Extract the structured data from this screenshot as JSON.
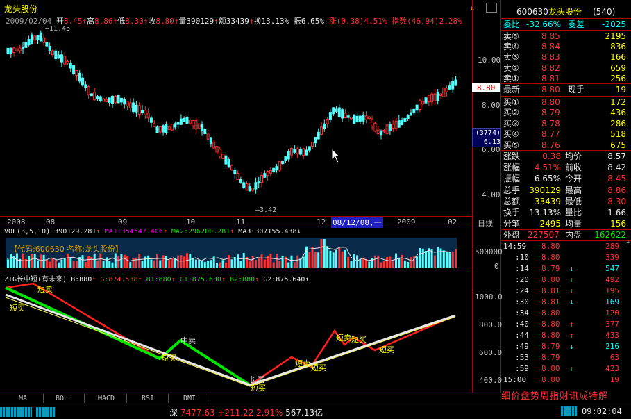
{
  "stock_name": "龙头股份",
  "quote": {
    "date": "2009/02/04",
    "open_label": "开",
    "open": "8.45",
    "high_label": "高",
    "high": "8.86",
    "low_label": "低",
    "low": "8.30",
    "close_label": "收",
    "close": "8.80",
    "vol_label": "量",
    "vol": "390129",
    "amt_label": "额",
    "amt": "33439",
    "turn_label": "换",
    "turn": "13.13%",
    "amp_label": "振",
    "amp": "6.65%",
    "chg_label": "涨",
    "chg": "(0.38)4.51%",
    "idx_label": "指数",
    "idx": "(46.94)2.28%"
  },
  "price_axis": [
    "10.00",
    "8.00",
    "6.00",
    "4.00"
  ],
  "price_tags": {
    "current": "8.80",
    "cursor_count": "(3774)",
    "cursor_price": "6.13"
  },
  "annotations": {
    "high": "11.45",
    "low": "3.42"
  },
  "x_axis": [
    "2008",
    "08",
    "09",
    "10",
    "11",
    "12",
    "08/12/08,一",
    "2009",
    "02"
  ],
  "x_axis_right": "日线",
  "volume": {
    "header": "VOL(3,5,10)",
    "vol": "390129.281",
    "ma1": "MA1:354547.406",
    "ma2": "MA2:296200.281",
    "ma3": "MA3:307155.438",
    "box": "【代码:600630  名称:龙头股份】",
    "axis": [
      "500000",
      "0"
    ]
  },
  "zig": {
    "name": "ZIG长中短(有未来)",
    "b": "B:880",
    "g": "G:874.538",
    "b1": "B1:880",
    "g1": "G1:875.630",
    "b2": "B2:880",
    "g2": "G2:875.640",
    "axis": [
      "1000.0",
      "800.0",
      "600.0",
      "400.0"
    ],
    "labels": {
      "short_buy": "短买",
      "short_sell": "短卖",
      "mid_sell": "中卖",
      "long_buy": "长买"
    }
  },
  "tabs": [
    "MA",
    "BOLL",
    "MACD",
    "RSI",
    "DMI"
  ],
  "right": {
    "code": "600630",
    "name": "龙头股份",
    "rank": "(540)",
    "weibi_label": "委比",
    "weibi": "-32.66%",
    "weicha_label": "委差",
    "weicha": "-2025",
    "asks": [
      {
        "label": "卖⑤",
        "price": "8.85",
        "vol": "2195"
      },
      {
        "label": "卖④",
        "price": "8.84",
        "vol": "836"
      },
      {
        "label": "卖③",
        "price": "8.83",
        "vol": "166"
      },
      {
        "label": "卖②",
        "price": "8.82",
        "vol": "659"
      },
      {
        "label": "卖①",
        "price": "8.81",
        "vol": "256"
      }
    ],
    "latest_label": "最新",
    "latest": "8.80",
    "hand_label": "现手",
    "hand": "19",
    "bids": [
      {
        "label": "买①",
        "price": "8.80",
        "vol": "172"
      },
      {
        "label": "买②",
        "price": "8.79",
        "vol": "436"
      },
      {
        "label": "买③",
        "price": "8.78",
        "vol": "286"
      },
      {
        "label": "买④",
        "price": "8.77",
        "vol": "518"
      },
      {
        "label": "买⑤",
        "price": "8.76",
        "vol": "675"
      }
    ],
    "stats": [
      {
        "l1": "涨跌",
        "v1": "0.38",
        "l2": "均价",
        "v2": "8.57"
      },
      {
        "l1": "涨幅",
        "v1": "4.51%",
        "l2": "前收",
        "v2": "8.42"
      },
      {
        "l1": "振幅",
        "v1": "6.65%",
        "l2": "今开",
        "v2": "8.45"
      },
      {
        "l1": "总手",
        "v1": "390129",
        "l2": "最高",
        "v2": "8.86"
      },
      {
        "l1": "总额",
        "v1": "33439",
        "l2": "最低",
        "v2": "8.30"
      },
      {
        "l1": "换手",
        "v1": "13.13%",
        "l2": "量比",
        "v2": "1.66"
      },
      {
        "l1": "分笔",
        "v1": "2495",
        "l2": "均量",
        "v2": "156"
      }
    ],
    "outer_label": "外盘",
    "outer": "227507",
    "inner_label": "内盘",
    "inner": "162622",
    "ticks": [
      {
        "t": "14:59",
        "p": "8.80",
        "a": "",
        "v": "289"
      },
      {
        "t": ":10",
        "p": "8.80",
        "a": "",
        "v": "339"
      },
      {
        "t": ":14",
        "p": "8.79",
        "a": "↓",
        "v": "547"
      },
      {
        "t": ":20",
        "p": "8.80",
        "a": "↑",
        "v": "492"
      },
      {
        "t": ":24",
        "p": "8.81",
        "a": "↑",
        "v": "195"
      },
      {
        "t": ":30",
        "p": "8.81",
        "a": "↓",
        "v": "169"
      },
      {
        "t": ":34",
        "p": "8.80",
        "a": "",
        "v": "120"
      },
      {
        "t": ":40",
        "p": "8.80",
        "a": "↑",
        "v": "377"
      },
      {
        "t": ":44",
        "p": "8.80",
        "a": "↑",
        "v": "433"
      },
      {
        "t": ":49",
        "p": "8.79",
        "a": "↓",
        "v": "216"
      },
      {
        "t": ":53",
        "p": "8.79",
        "a": "",
        "v": "63"
      },
      {
        "t": ":59",
        "p": "8.80",
        "a": "↑",
        "v": "423"
      },
      {
        "t": "15:00",
        "p": "8.80",
        "a": "",
        "v": "19"
      }
    ],
    "bottom_tabs": "细价盘势周指财讯成特解"
  },
  "status": {
    "market": "深",
    "index": "7477.63",
    "change": "+211.22",
    "pct": "2.91%",
    "amount": "567.13亿",
    "time": "09:02:04"
  },
  "colors": {
    "up": "#ff3232",
    "down": "#00ffff",
    "frame": "#b40000"
  }
}
